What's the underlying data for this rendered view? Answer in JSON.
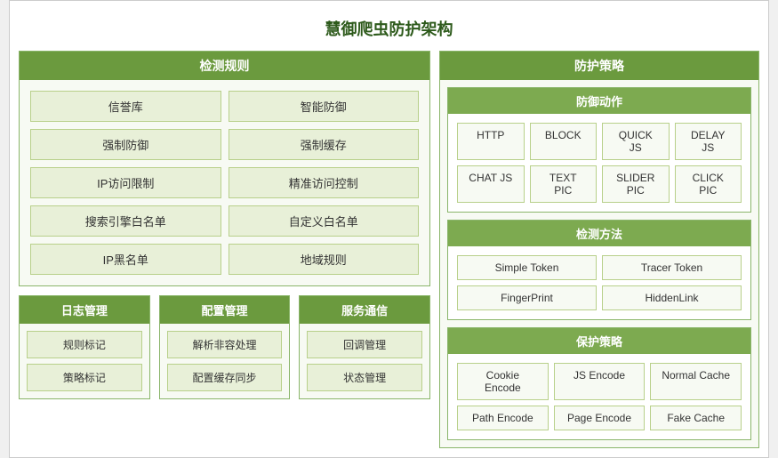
{
  "title": "慧御爬虫防护架构",
  "left": {
    "detect_rules": {
      "header": "检测规则",
      "items": [
        "信誉库",
        "智能防御",
        "强制防御",
        "强制缓存",
        "IP访问限制",
        "精准访问控制",
        "搜索引擎白名单",
        "自定义白名单",
        "IP黑名单",
        "地域规则"
      ]
    },
    "bottom": [
      {
        "header": "日志管理",
        "items": [
          "规则标记",
          "策略标记"
        ]
      },
      {
        "header": "配置管理",
        "items": [
          "解析非容处理",
          "配置缓存同步"
        ]
      },
      {
        "header": "服务通信",
        "items": [
          "回调管理",
          "状态管理"
        ]
      }
    ]
  },
  "right": {
    "defense_policy": {
      "header": "防护策略",
      "defense_actions": {
        "header": "防御动作",
        "rows": [
          [
            "HTTP",
            "BLOCK",
            "QUICK JS",
            "DELAY JS"
          ],
          [
            "CHAT JS",
            "TEXT PIC",
            "SLIDER PIC",
            "CLICK PIC"
          ]
        ]
      },
      "detect_methods": {
        "header": "检测方法",
        "rows": [
          [
            "Simple Token",
            "Tracer Token"
          ],
          [
            "FingerPrint",
            "HiddenLink"
          ]
        ]
      },
      "protect_policy": {
        "header": "保护策略",
        "rows": [
          [
            "Cookie Encode",
            "JS Encode",
            "Normal Cache"
          ],
          [
            "Path Encode",
            "Page Encode",
            "Fake Cache"
          ]
        ]
      }
    }
  }
}
